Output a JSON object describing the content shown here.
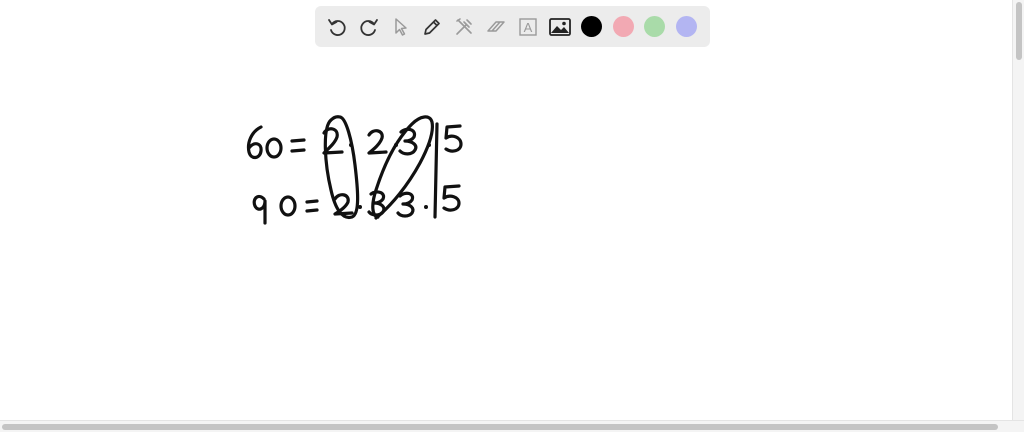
{
  "toolbar": {
    "tools": [
      {
        "name": "undo",
        "icon": "undo-icon",
        "color": "#333333"
      },
      {
        "name": "redo",
        "icon": "redo-icon",
        "color": "#333333"
      },
      {
        "name": "select",
        "icon": "pointer-icon",
        "color": "#9a9a9a"
      },
      {
        "name": "pen",
        "icon": "pencil-icon",
        "color": "#333333"
      },
      {
        "name": "tools",
        "icon": "tools-icon",
        "color": "#9a9a9a"
      },
      {
        "name": "eraser",
        "icon": "eraser-icon",
        "color": "#9a9a9a"
      },
      {
        "name": "text",
        "icon": "text-icon",
        "color": "#9a9a9a",
        "glyph": "A"
      },
      {
        "name": "image",
        "icon": "image-icon",
        "color": "#333333"
      }
    ],
    "colors": [
      "#000000",
      "#f2a9b3",
      "#a9dba9",
      "#b3b5f2"
    ]
  },
  "canvas": {
    "handwriting": [
      {
        "label": "60",
        "row1": [
          "2",
          "2",
          "3",
          "5"
        ]
      },
      {
        "label": "90",
        "row2": [
          "2",
          "3",
          "3",
          "5"
        ]
      }
    ],
    "ink_color": "#111111"
  }
}
